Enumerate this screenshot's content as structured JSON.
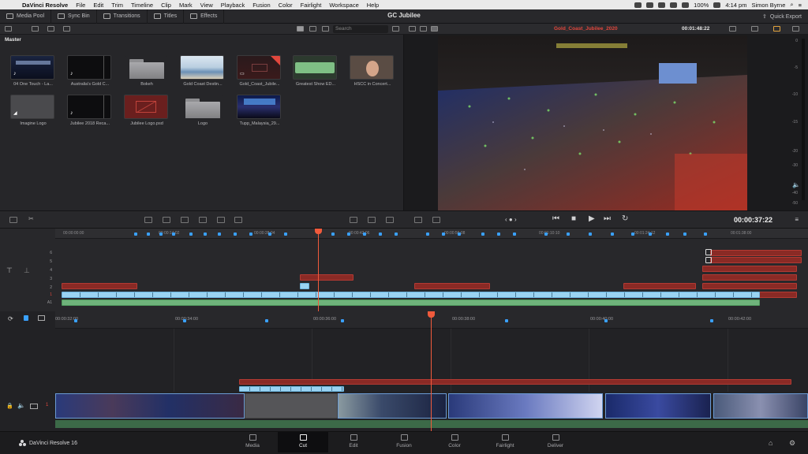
{
  "menubar": {
    "app": "DaVinci Resolve",
    "items": [
      "File",
      "Edit",
      "Trim",
      "Timeline",
      "Clip",
      "Mark",
      "View",
      "Playback",
      "Fusion",
      "Color",
      "Fairlight",
      "Workspace",
      "Help"
    ],
    "battery": "100%",
    "time": "4:14 pm",
    "user": "Simon Byrne"
  },
  "header": {
    "buttons": [
      "Media Pool",
      "Sync Bin",
      "Transitions",
      "Titles",
      "Effects"
    ],
    "project_title": "GC Jubilee",
    "quick_export": "Quick Export"
  },
  "media_pool": {
    "bin_name": "Master",
    "search_placeholder": "Search",
    "clips": [
      {
        "label": "04 One Touch - La...",
        "thumb": "concert-audio"
      },
      {
        "label": "Australia's Gold C...",
        "thumb": "black-audio"
      },
      {
        "label": "Bokeh",
        "thumb": "folder"
      },
      {
        "label": "Gold Coast Destin...",
        "thumb": "beach"
      },
      {
        "label": "Gold_Coast_Jubile...",
        "thumb": "timeline"
      },
      {
        "label": "Greatest Show ED...",
        "thumb": "green-audio"
      },
      {
        "label": "HSCC in Concert...",
        "thumb": "person"
      },
      {
        "label": "Imagine Logo",
        "thumb": "gray"
      },
      {
        "label": "Jubilee 2018 Reca...",
        "thumb": "black-audio"
      },
      {
        "label": "Jubilee Logo.psd",
        "thumb": "red-logo"
      },
      {
        "label": "Logo",
        "thumb": "folder"
      },
      {
        "label": "Tupp_Malaysia_29...",
        "thumb": "stage"
      }
    ]
  },
  "viewer": {
    "clip_name": "Gold_Coast_Jubilee_2020",
    "duration_tc": "00:01:48:22",
    "current_tc": "00:00:37:22",
    "meter_ticks": [
      "0",
      "-5",
      "-10",
      "-15",
      "-20",
      "-30",
      "-40",
      "-50"
    ]
  },
  "upper_timeline": {
    "timecodes": [
      "00:00:00:00",
      "00:00:14:02",
      "00:00:28:04",
      "00:00:42:06",
      "00:00:56:08",
      "00:01:10:10",
      "00:01:24:12",
      "00:01:38:00"
    ],
    "track_numbers": [
      "6",
      "5",
      "4",
      "3",
      "2",
      "1",
      "A1"
    ]
  },
  "lower_timeline": {
    "timecodes": [
      "00:00:32:00",
      "00:00:34:00",
      "00:00:36:00",
      "00:00:38:00",
      "00:00:40:00",
      "00:00:42:00"
    ],
    "track_label": "1"
  },
  "pages": [
    "Media",
    "Cut",
    "Edit",
    "Fusion",
    "Color",
    "Fairlight",
    "Deliver"
  ],
  "active_page": "Cut",
  "brand": "DaVinci Resolve 16",
  "colors": {
    "accent_red": "#e2473d",
    "playhead": "#f05a3c",
    "marker_blue": "#3aa1ff",
    "clip_blue": "#9ad3f2",
    "clip_red": "#8a2a25",
    "clip_green": "#6fb37b"
  }
}
